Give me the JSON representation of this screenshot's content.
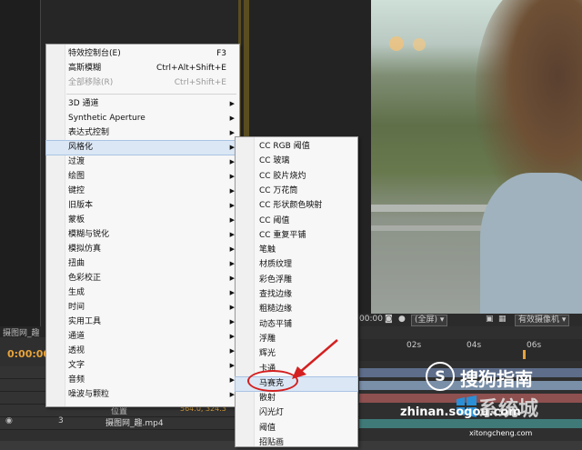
{
  "menu": {
    "items": [
      {
        "label": "特效控制台(E)",
        "shortcut": "F3",
        "disabled": false,
        "submenu": false
      },
      {
        "label": "高斯模糊",
        "shortcut": "Ctrl+Alt+Shift+E",
        "disabled": false,
        "submenu": false
      },
      {
        "label": "全部移除(R)",
        "shortcut": "Ctrl+Shift+E",
        "disabled": true,
        "submenu": false
      },
      {
        "label": "3D 通道",
        "submenu": true
      },
      {
        "label": "Synthetic Aperture",
        "submenu": true
      },
      {
        "label": "表达式控制",
        "submenu": true
      },
      {
        "label": "风格化",
        "submenu": true,
        "highlighted": true
      },
      {
        "label": "过渡",
        "submenu": true
      },
      {
        "label": "绘图",
        "submenu": true
      },
      {
        "label": "键控",
        "submenu": true
      },
      {
        "label": "旧版本",
        "submenu": true
      },
      {
        "label": "蒙板",
        "submenu": true
      },
      {
        "label": "模糊与锐化",
        "submenu": true
      },
      {
        "label": "模拟仿真",
        "submenu": true
      },
      {
        "label": "扭曲",
        "submenu": true
      },
      {
        "label": "色彩校正",
        "submenu": true
      },
      {
        "label": "生成",
        "submenu": true
      },
      {
        "label": "时间",
        "submenu": true
      },
      {
        "label": "实用工具",
        "submenu": true
      },
      {
        "label": "通道",
        "submenu": true
      },
      {
        "label": "透视",
        "submenu": true
      },
      {
        "label": "文字",
        "submenu": true
      },
      {
        "label": "音频",
        "submenu": true
      },
      {
        "label": "噪波与颗粒",
        "submenu": true
      }
    ]
  },
  "submenu": {
    "items": [
      "CC RGB 阈值",
      "CC 玻璃",
      "CC 胶片烧灼",
      "CC 万花筒",
      "CC 形状颜色映射",
      "CC 阈值",
      "CC 重复平铺",
      "笔触",
      "材质纹理",
      "彩色浮雕",
      "查找边缘",
      "粗糙边缘",
      "动态平铺",
      "浮雕",
      "辉光",
      "卡通",
      "马赛克",
      "散射",
      "闪光灯",
      "阈值",
      "招贴画"
    ],
    "highlighted_index": 16
  },
  "viewer": {
    "timecode": "00:00",
    "resolution": "(全屏)",
    "camera": "有效摄像机"
  },
  "timeline": {
    "tab_label": "摄图网_趣",
    "time": "0:00:00",
    "ruler": [
      "02s",
      "04s",
      "06s"
    ],
    "layer_number": "3",
    "layer_name": "摄图网_趣.mp4",
    "prop_label": "位置",
    "prop_value": "564.0, 324.3"
  },
  "watermark": {
    "sogou": "搜狗指南",
    "url1": "zhinan.sogou.com",
    "sys": "系统城",
    "url2": "xitongcheng.com"
  },
  "colors": {
    "menu_bg": "#f7f7f7",
    "highlight": "#dbe7f5",
    "annotation": "#d42020",
    "time_orange": "#e8a33a"
  }
}
